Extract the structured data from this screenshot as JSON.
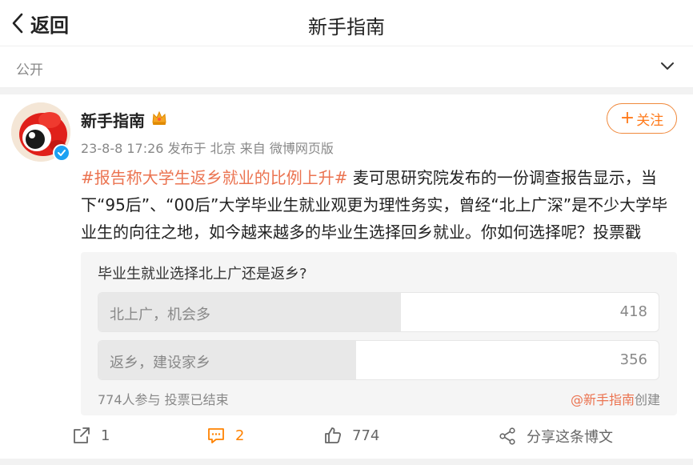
{
  "header": {
    "back_label": "返回",
    "title": "新手指南"
  },
  "visibility": {
    "label": "公开"
  },
  "post": {
    "author": "新手指南",
    "timestamp": "23-8-8 17:26",
    "published_prefix": "发布于",
    "location": "北京",
    "source_prefix": "来自",
    "source": "微博网页版",
    "follow_label": "关注",
    "hashtag": "#报告称大学生返乡就业的比例上升#",
    "body": " 麦可思研究院发布的一份调查报告显示，当下“95后”、“00后”大学毕业生就业观更为理性务实，曾经“北上广深”是不少大学毕业生的向往之地，如今越来越多的毕业生选择回乡就业。你如何选择呢？投票戳"
  },
  "poll": {
    "question": "毕业生就业选择北上广还是返乡?",
    "options": [
      {
        "label": "北上广，机会多",
        "count": "418",
        "share": 0.54
      },
      {
        "label": "返乡，建设家乡",
        "count": "356",
        "share": 0.46
      }
    ],
    "participants": "774人参与",
    "status": "投票已结束",
    "creator": "@新手指南",
    "creator_suffix": "创建"
  },
  "actions": {
    "share_count": "1",
    "comment_count": "2",
    "like_count": "774",
    "share_post_label": "分享这条博文"
  },
  "colors": {
    "accent": "#ff8200",
    "hashtag": "#eb7350",
    "verified": "#1da1f2",
    "muted": "#888888"
  }
}
